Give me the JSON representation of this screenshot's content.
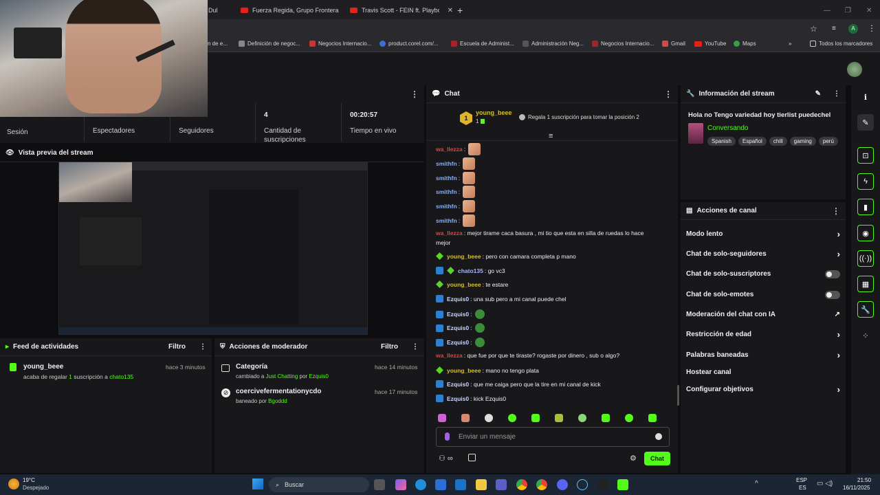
{
  "browser": {
    "tabs": [
      {
        "label": "Dul"
      },
      {
        "label": "Fuerza Regida, Grupo Frontera"
      },
      {
        "label": "Travis Scott - FEIN ft. Playboi Ca"
      }
    ],
    "bookmarks": [
      "n de e...",
      "Definición de negoc...",
      "Negocios Internacio...",
      "product.corel.com/...",
      "Escuela de Administ...",
      "Administración Neg...",
      "Negocios Internacio...",
      "Gmail",
      "YouTube",
      "Maps"
    ],
    "all_bookmarks": "Todos los marcadores",
    "profile_initial": "A"
  },
  "stats": {
    "session_label": "Sesión",
    "viewers_label": "Espectadores",
    "followers_label": "Seguidores",
    "subs_value": "4",
    "subs_label": "Cantidad de suscripciones",
    "time_value": "00:20:57",
    "time_label": "Tiempo en vivo"
  },
  "preview": {
    "title": "Vista previa del stream"
  },
  "activity": {
    "title": "Feed de actividades",
    "filter": "Filtro",
    "item": {
      "user": "young_beee",
      "time": "hace 3 minutos",
      "pre": "acaba de regalar ",
      "n": "1",
      "mid": " suscripción a ",
      "target": "chato135"
    }
  },
  "modactions": {
    "title": "Acciones de moderador",
    "filter": "Filtro",
    "items": [
      {
        "title": "Categoría",
        "time": "hace 14 minutos",
        "pre": "cambiado a ",
        "val": "Just Chatting",
        "mid": " por ",
        "by": "Ezquis0"
      },
      {
        "title": "coercivefermentationycdo",
        "time": "hace 17 minutos",
        "pre": "baneado por ",
        "val": "",
        "mid": "",
        "by": "Bgoddd"
      }
    ]
  },
  "chat": {
    "title": "Chat",
    "pinned_user": "young_beee",
    "pinned_count": "1",
    "pinned_rank": "1",
    "gift_prompt": "Regala 1 suscripción para tomar la posición 2",
    "messages": [
      {
        "user": "wa_llezza",
        "color": "#e0453c",
        "text": ":",
        "emote": "hand"
      },
      {
        "user": "smithfn",
        "color": "#7fb0ff",
        "text": ":",
        "emote": "face"
      },
      {
        "user": "smithfn",
        "color": "#7fb0ff",
        "text": ":",
        "emote": "face"
      },
      {
        "user": "smithfn",
        "color": "#7fb0ff",
        "text": ":",
        "emote": "face"
      },
      {
        "user": "smithfn",
        "color": "#7fb0ff",
        "text": ":",
        "emote": "face"
      },
      {
        "user": "smithfn",
        "color": "#7fb0ff",
        "text": ":",
        "emote": "face"
      },
      {
        "user": "wa_llezza",
        "color": "#e0453c",
        "text": ": mejor tirame caca basura , mi tio que esta en silla de ruedas lo hace",
        "text2": "mejor"
      },
      {
        "user": "young_beee",
        "color": "#d4c221",
        "badges": [
          "grn"
        ],
        "text": ": pero con camara completa p mano"
      },
      {
        "user": "chato135",
        "color": "#9fb8ff",
        "badges": [
          "blue",
          "grn"
        ],
        "text": ": go vc3"
      },
      {
        "user": "young_beee",
        "color": "#d4c221",
        "badges": [
          "grn"
        ],
        "text": ": te estare"
      },
      {
        "user": "Ezquis0",
        "color": "#c9d6ff",
        "badges": [
          "blue"
        ],
        "text": ": una sub pero a mi canal puede chel"
      },
      {
        "user": "Ezquis0",
        "color": "#c9d6ff",
        "badges": [
          "blue"
        ],
        "text": ":",
        "emote": "pepe"
      },
      {
        "user": "Ezquis0",
        "color": "#c9d6ff",
        "badges": [
          "blue"
        ],
        "text": ":",
        "emote": "pepe"
      },
      {
        "user": "Ezquis0",
        "color": "#c9d6ff",
        "badges": [
          "blue"
        ],
        "text": ":",
        "emote": "pepe"
      },
      {
        "user": "wa_llezza",
        "color": "#e0453c",
        "text": ": que fue por que te tiraste? rogaste por dinero , sub o algo?"
      },
      {
        "user": "young_beee",
        "color": "#d4c221",
        "badges": [
          "grn"
        ],
        "text": ": mano no tengo plata"
      },
      {
        "user": "Ezquis0",
        "color": "#c9d6ff",
        "badges": [
          "blue"
        ],
        "text": ": que me caiga pero que la tire en mi canal de kick"
      },
      {
        "user": "Ezquis0",
        "color": "#c9d6ff",
        "badges": [
          "blue"
        ],
        "text": ": kick Ezquis0"
      }
    ],
    "input_placeholder": "Enviar un mensaje",
    "send_label": "Chat"
  },
  "info": {
    "title": "Información del stream",
    "stream_title": "Hola no Tengo variedad hoy tierlist puedechel",
    "category": "Conversando",
    "tags": [
      "Spanish",
      "Español",
      "chill",
      "gaming",
      "perú"
    ]
  },
  "channel": {
    "title": "Acciones de canal",
    "rows": [
      {
        "label": "Modo lento",
        "kind": "chev"
      },
      {
        "label": "Chat de solo-seguidores",
        "kind": "chev"
      },
      {
        "label": "Chat de solo-suscriptores",
        "kind": "toggle"
      },
      {
        "label": "Chat de solo-emotes",
        "kind": "toggle"
      },
      {
        "label": "Moderación del chat con IA",
        "kind": "ext"
      },
      {
        "label": "Restricción de edad",
        "kind": "chev"
      },
      {
        "label": "Palabras baneadas",
        "kind": "chev"
      },
      {
        "label": "Hostear canal",
        "kind": "none"
      },
      {
        "label": "Configurar objetivos",
        "kind": "chev"
      }
    ]
  },
  "taskbar": {
    "temp": "19°C",
    "weather": "Despejado",
    "search": "Buscar",
    "lang1": "ESP",
    "lang2": "ES",
    "time": "21:50",
    "date": "16/11/2025"
  },
  "colors": {
    "accent": "#53fc18",
    "bg": "#0e0e10",
    "panel": "#18181b"
  }
}
